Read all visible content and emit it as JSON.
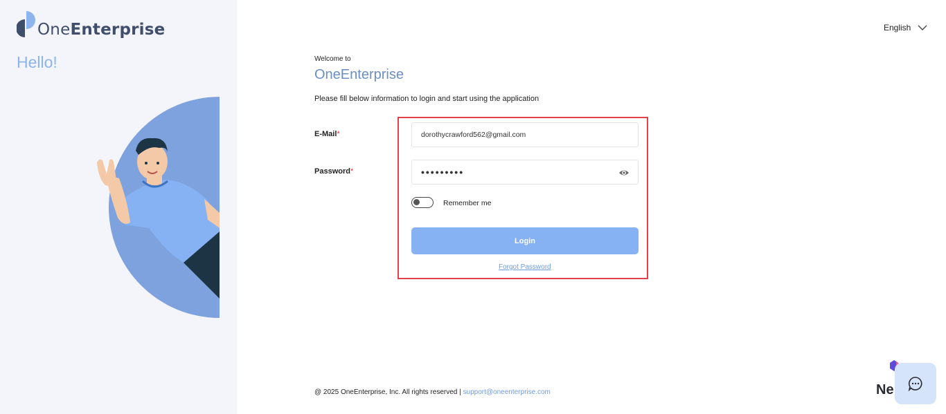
{
  "brand": {
    "logo_prefix": "One",
    "logo_suffix": "Enterprise",
    "hello": "Hello!"
  },
  "language": {
    "selected": "English"
  },
  "form": {
    "welcome": "Welcome to",
    "title": "OneEnterprise",
    "subtitle": "Please fill below information to login and start using the application",
    "email_label": "E-Mail",
    "email_value": "dorothycrawford562@gmail.com",
    "password_label": "Password",
    "password_value": "•••••••••",
    "required_mark": "*",
    "remember_label": "Remember me",
    "login_label": "Login",
    "forgot_label": "Forgot Password"
  },
  "footer": {
    "copyright": "@ 2025 OneEnterprise, Inc. All rights reserved | ",
    "support_email": "support@oneenterprise.com"
  },
  "widget": {
    "ne_text": "Ne"
  },
  "colors": {
    "accent": "#86b1f3",
    "brand_title": "#6b8fc4",
    "highlight": "#e5404a",
    "left_bg": "#f4f5fa"
  },
  "icons": [
    "logo-mark-icon",
    "chevron-down-icon",
    "eye-icon",
    "chat-icon",
    "ne-logo-icon"
  ]
}
